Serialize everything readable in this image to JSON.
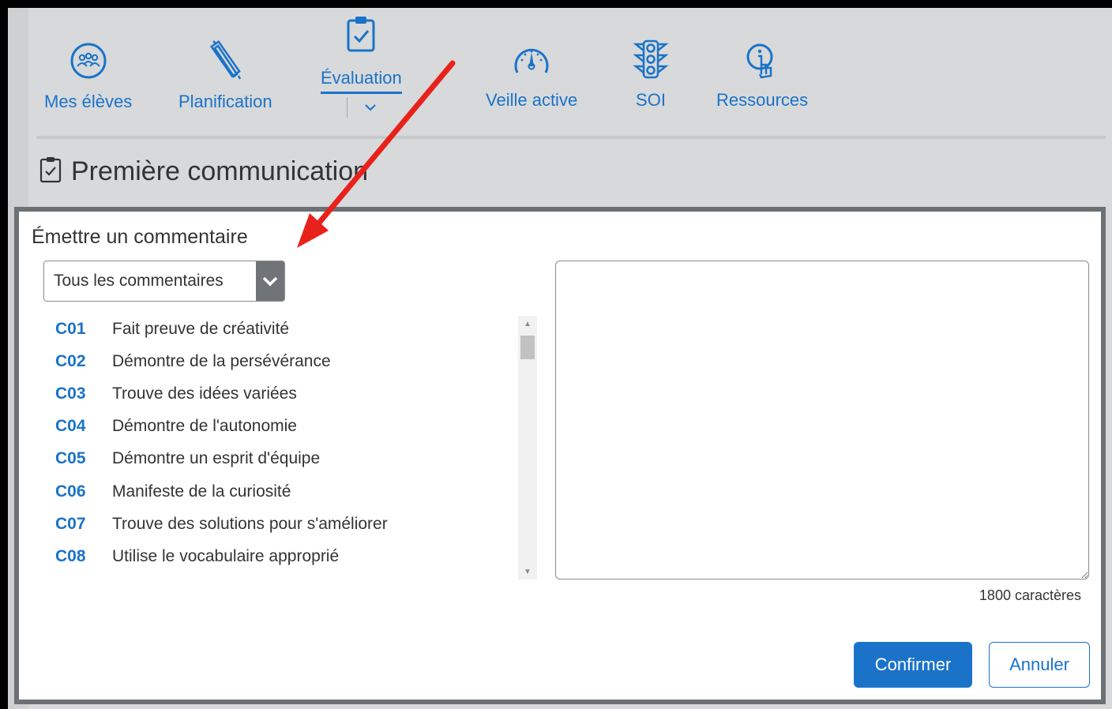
{
  "nav": {
    "items": [
      {
        "label": "Mes élèves",
        "icon": "students-group-icon"
      },
      {
        "label": "Planification",
        "icon": "ruler-pencil-icon"
      },
      {
        "label": "Évaluation",
        "icon": "clipboard-check-icon",
        "active": true
      },
      {
        "label": "Veille active",
        "icon": "gauge-icon"
      },
      {
        "label": "SOI",
        "icon": "traffic-light-icon"
      },
      {
        "label": "Ressources",
        "icon": "info-hand-icon"
      }
    ]
  },
  "page": {
    "title": "Première communication",
    "icon": "clipboard-check-icon"
  },
  "modal": {
    "title": "Émettre un commentaire",
    "filter": {
      "selected": "Tous les commentaires"
    },
    "comments": [
      {
        "code": "C01",
        "text": "Fait preuve de créativité"
      },
      {
        "code": "C02",
        "text": "Démontre de la persévérance"
      },
      {
        "code": "C03",
        "text": "Trouve des idées variées"
      },
      {
        "code": "C04",
        "text": "Démontre de l'autonomie"
      },
      {
        "code": "C05",
        "text": "Démontre un esprit d'équipe"
      },
      {
        "code": "C06",
        "text": "Manifeste de la curiosité"
      },
      {
        "code": "C07",
        "text": "Trouve des solutions pour s'améliorer"
      },
      {
        "code": "C08",
        "text": "Utilise le vocabulaire approprié"
      }
    ],
    "comment_value": "",
    "char_count": "1800 caractères",
    "confirm_label": "Confirmer",
    "cancel_label": "Annuler"
  },
  "colors": {
    "accent": "#1a73c8",
    "annotation_arrow": "#e8221b",
    "select_button": "#707478",
    "modal_border": "#6c7176"
  }
}
